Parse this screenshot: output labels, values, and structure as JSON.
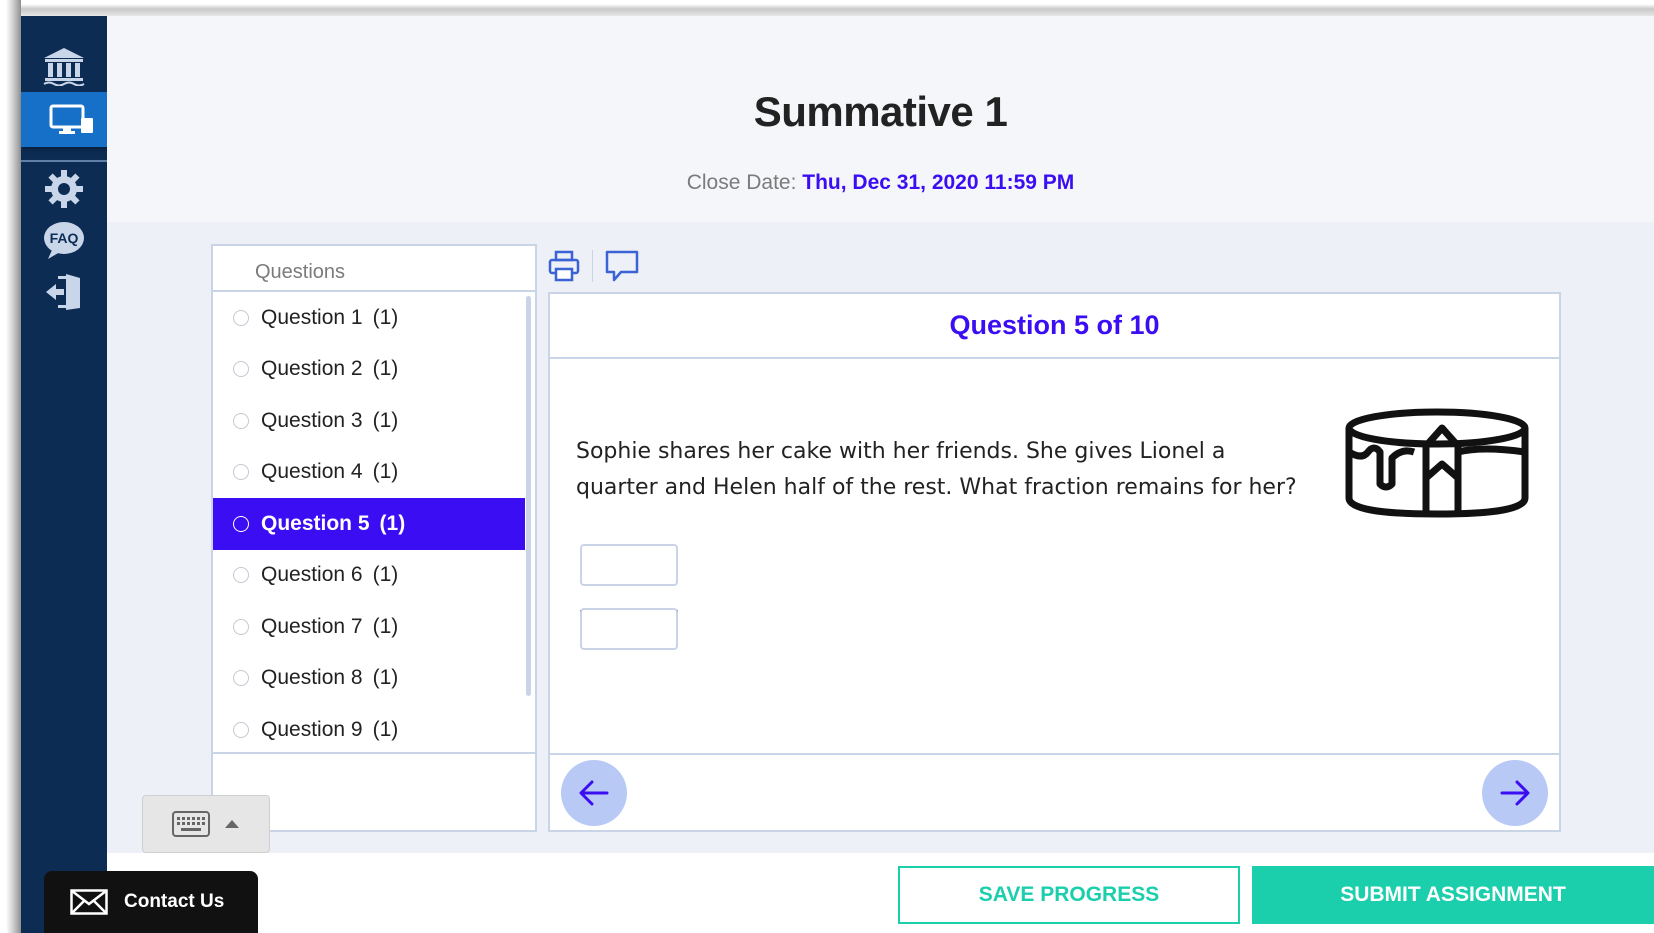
{
  "header": {
    "title": "Summative 1",
    "close_label": "Close Date:",
    "close_value": "Thu, Dec 31, 2020 11:59 PM"
  },
  "sidebar": {
    "items": [
      {
        "icon": "institution-icon"
      },
      {
        "icon": "computer-icon",
        "active": true
      },
      {
        "icon": "gear-icon"
      },
      {
        "icon": "faq-icon",
        "label": "FAQ"
      },
      {
        "icon": "exit-icon"
      }
    ]
  },
  "questions_panel": {
    "heading": "Questions",
    "items": [
      {
        "label": "Question 1",
        "points": "(1)"
      },
      {
        "label": "Question 2",
        "points": "(1)"
      },
      {
        "label": "Question 3",
        "points": "(1)"
      },
      {
        "label": "Question 4",
        "points": "(1)"
      },
      {
        "label": "Question 5",
        "points": "(1)",
        "active": true
      },
      {
        "label": "Question 6",
        "points": "(1)"
      },
      {
        "label": "Question 7",
        "points": "(1)"
      },
      {
        "label": "Question 8",
        "points": "(1)"
      },
      {
        "label": "Question 9",
        "points": "(1)"
      }
    ]
  },
  "question": {
    "heading": "Question 5 of 10",
    "text": "Sophie shares her cake with her friends. She gives Lionel a quarter and Helen half of the rest. What fraction remains for her?",
    "numerator_value": "",
    "denominator_value": "",
    "image_icon": "cake-icon"
  },
  "toolbar": {
    "print_icon": "print-icon",
    "comment_icon": "comment-icon"
  },
  "footer": {
    "contact_label": "Contact Us",
    "save_label": "SAVE PROGRESS",
    "submit_label": "SUBMIT ASSIGNMENT"
  },
  "colors": {
    "accent": "#3b0df2",
    "sidebar": "#0d2c54",
    "active_sidebar": "#1670c7",
    "teal": "#1bcfac",
    "nav_button": "#b8c9f5"
  }
}
